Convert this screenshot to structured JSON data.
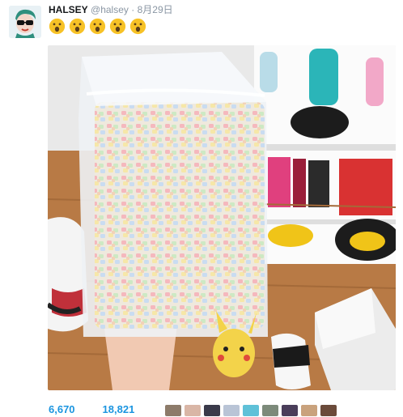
{
  "tweet": {
    "author": {
      "display_name": "HALSEY",
      "handle": "@halsey",
      "avatar_icon": "avatar-illustration-icon"
    },
    "separator": "·",
    "timestamp": "8月29日",
    "emoji": [
      "open-mouth-face-icon",
      "open-mouth-face-icon",
      "open-mouth-face-icon",
      "open-mouth-face-icon",
      "open-mouth-face-icon"
    ],
    "photo_icon": "photo-bag-of-marshmallows",
    "stats": {
      "retweets": "6,670",
      "likes": "18,821"
    },
    "liker_avatars": 10,
    "colors": {
      "accent": "#1b95e0",
      "name": "#14171a",
      "muted": "#8a96a3",
      "emoji": "#f7c226"
    }
  }
}
